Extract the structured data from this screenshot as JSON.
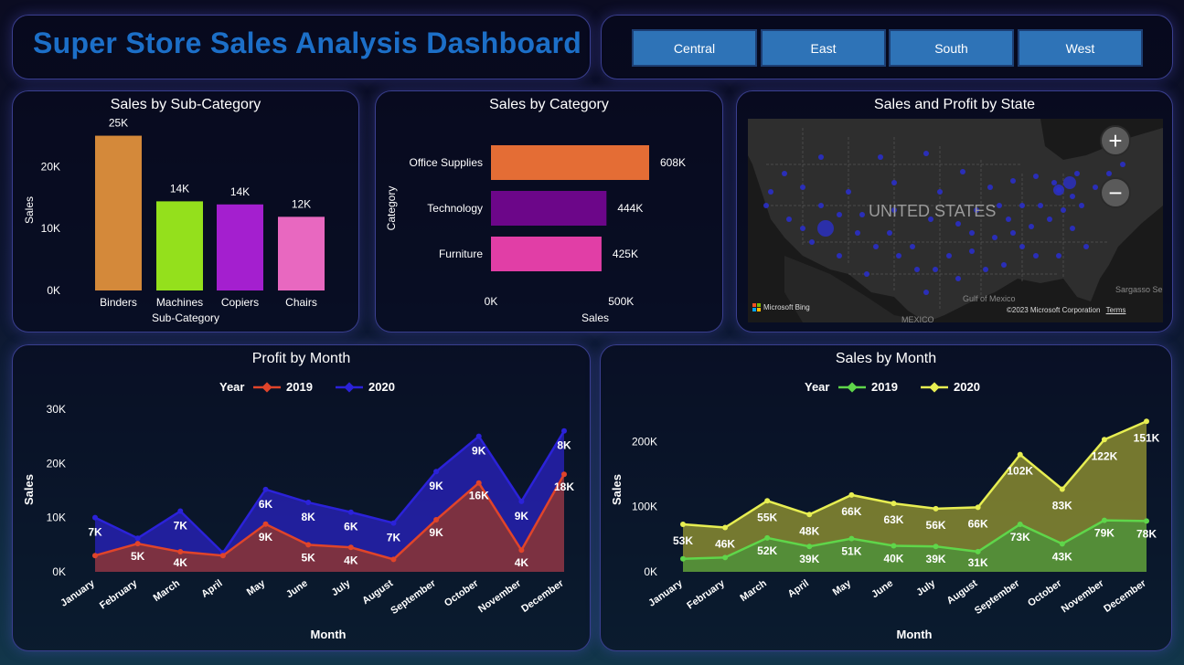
{
  "header": {
    "title": "Super Store Sales Analysis Dashboard"
  },
  "regions": [
    "Central",
    "East",
    "South",
    "West"
  ],
  "map": {
    "title": "Sales and Profit by State",
    "country_label": "UNITED STATES",
    "gulf_label": "Gulf of Mexico",
    "sargasso_label": "Sargasso Se",
    "mexico_label": "MEXICO",
    "bing_label": "Microsoft Bing",
    "copyright": "©2023 Microsoft Corporation",
    "terms": "Terms",
    "zoom_in": "+",
    "zoom_out": "−",
    "colors": {
      "land": "#2e2e2e",
      "water": "#1a1a1a",
      "dot": "#2a2fc8"
    }
  },
  "colors": {
    "title": "#1c6fc8",
    "region_button": "#2e73b7",
    "profit_2019": "#e0442a",
    "profit_2020": "#2b22d9",
    "sales_2019": "#5fd64a",
    "sales_2020": "#e7ee52"
  },
  "chart_data": [
    {
      "id": "subcat",
      "type": "bar",
      "title": "Sales by Sub-Category",
      "xlabel": "Sub-Category",
      "ylabel": "Sales",
      "categories": [
        "Binders",
        "Machines",
        "Copiers",
        "Chairs"
      ],
      "values": [
        25000,
        14400,
        13900,
        11900
      ],
      "labels": [
        "25K",
        "14K",
        "14K",
        "12K"
      ],
      "colors": [
        "#d4893a",
        "#94e01c",
        "#a41fcf",
        "#e868c0"
      ],
      "yticks": [
        0,
        10000,
        20000
      ],
      "ytick_labels": [
        "0K",
        "10K",
        "20K"
      ],
      "ylim": [
        0,
        27000
      ]
    },
    {
      "id": "category",
      "type": "bar",
      "orientation": "horizontal",
      "title": "Sales by Category",
      "xlabel": "Sales",
      "ylabel": "Category",
      "categories": [
        "Office Supplies",
        "Technology",
        "Furniture"
      ],
      "values": [
        608000,
        444000,
        425000
      ],
      "labels": [
        "608K",
        "444K",
        "425K"
      ],
      "colors": [
        "#e46d35",
        "#6c0689",
        "#e13ea6"
      ],
      "xticks": [
        0,
        500000
      ],
      "xtick_labels": [
        "0K",
        "500K"
      ],
      "xlim": [
        0,
        608000
      ]
    },
    {
      "id": "profit",
      "type": "area",
      "title": "Profit by Month",
      "xlabel": "Month",
      "ylabel": "Sales",
      "legend_title": "Year",
      "categories": [
        "January",
        "February",
        "March",
        "April",
        "May",
        "June",
        "July",
        "August",
        "September",
        "October",
        "November",
        "December"
      ],
      "yticks": [
        0,
        10000,
        20000,
        30000
      ],
      "ytick_labels": [
        "0K",
        "10K",
        "20K",
        "30K"
      ],
      "ylim": [
        0,
        30000
      ],
      "series": [
        {
          "name": "2019",
          "color": "#e0442a",
          "fill": "rgba(150,55,40,0.78)",
          "values": [
            3000,
            5200,
            3700,
            3000,
            8800,
            5000,
            4500,
            2300,
            9600,
            16400,
            4000,
            18000
          ],
          "labels": [
            "",
            "5K",
            "4K",
            "",
            "9K",
            "5K",
            "4K",
            "",
            "9K",
            "16K",
            "4K",
            "18K"
          ]
        },
        {
          "name": "2020",
          "color": "#2b22d9",
          "fill": "rgba(43,34,200,0.72)",
          "values": [
            10000,
            6200,
            11200,
            3500,
            15200,
            12800,
            11000,
            9000,
            18500,
            25000,
            13000,
            26000
          ],
          "labels": [
            "7K",
            "",
            "7K",
            "",
            "6K",
            "8K",
            "6K",
            "7K",
            "9K",
            "9K",
            "9K",
            "8K"
          ]
        }
      ]
    },
    {
      "id": "sales",
      "type": "area",
      "title": "Sales by Month",
      "xlabel": "Month",
      "ylabel": "Sales",
      "legend_title": "Year",
      "categories": [
        "January",
        "February",
        "March",
        "April",
        "May",
        "June",
        "July",
        "August",
        "September",
        "October",
        "November",
        "December"
      ],
      "yticks": [
        0,
        100000,
        200000
      ],
      "ytick_labels": [
        "0K",
        "100K",
        "200K"
      ],
      "ylim": [
        0,
        230000
      ],
      "series": [
        {
          "name": "2019",
          "color": "#5fd64a",
          "fill": "rgba(70,150,60,0.7)",
          "values": [
            20000,
            22000,
            52000,
            39000,
            51000,
            40000,
            39000,
            31000,
            73000,
            43000,
            79000,
            78000
          ],
          "labels": [
            "",
            "",
            "52K",
            "39K",
            "51K",
            "40K",
            "39K",
            "31K",
            "73K",
            "43K",
            "79K",
            "78K"
          ]
        },
        {
          "name": "2020",
          "color": "#e7ee52",
          "fill": "rgba(160,160,50,0.72)",
          "values": [
            73000,
            68000,
            109000,
            88000,
            118000,
            105000,
            97000,
            99000,
            180000,
            127000,
            203000,
            231000
          ],
          "labels": [
            "53K",
            "46K",
            "55K",
            "48K",
            "66K",
            "63K",
            "56K",
            "66K",
            "102K",
            "83K",
            "122K",
            "151K"
          ]
        }
      ]
    }
  ]
}
